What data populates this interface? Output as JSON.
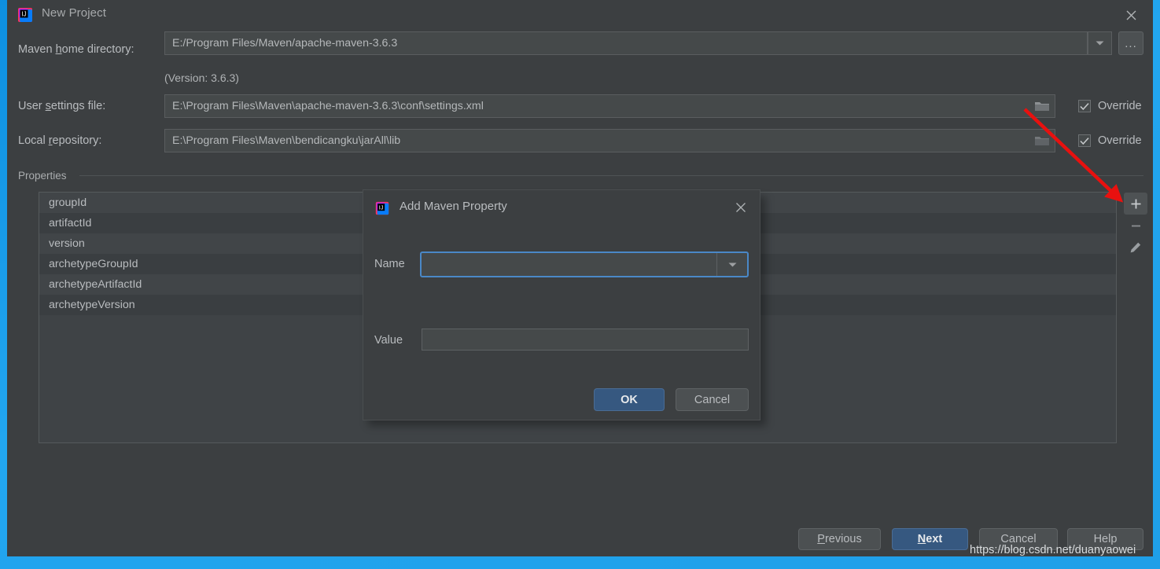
{
  "window": {
    "title": "New Project",
    "logo_icon": "intellij-idea-logo",
    "close_icon": "close-icon"
  },
  "form": {
    "maven_home": {
      "label_pre": "Maven ",
      "label_mnemonic": "h",
      "label_post": "ome directory:",
      "value": "E:/Program Files/Maven/apache-maven-3.6.3",
      "dropdown_icon": "chevron-down-icon",
      "browse_label": "...",
      "version_note": "(Version: 3.6.3)"
    },
    "user_settings": {
      "label_pre": "User ",
      "label_mnemonic": "s",
      "label_post": "ettings file:",
      "value": "E:\\Program Files\\Maven\\apache-maven-3.6.3\\conf\\settings.xml",
      "folder_icon": "folder-icon",
      "override_label": "Override",
      "override_checked": true
    },
    "local_repository": {
      "label_pre": "Local ",
      "label_mnemonic": "r",
      "label_post": "epository:",
      "value": "E:\\Program Files\\Maven\\bendicangku\\jarAll\\lib",
      "folder_icon": "folder-icon",
      "override_label": "Override",
      "override_checked": true
    }
  },
  "properties": {
    "section_label": "Properties",
    "rows": [
      "groupId",
      "artifactId",
      "version",
      "archetypeGroupId",
      "archetypeArtifactId",
      "archetypeVersion"
    ],
    "tools": [
      {
        "name": "add-property-button",
        "icon": "plus-icon",
        "hovered": true
      },
      {
        "name": "remove-property-button",
        "icon": "minus-icon",
        "hovered": false
      },
      {
        "name": "edit-property-button",
        "icon": "pencil-icon",
        "hovered": false
      }
    ]
  },
  "modal": {
    "title": "Add Maven Property",
    "logo_icon": "intellij-idea-logo",
    "close_icon": "close-icon",
    "name_label": "Name",
    "name_value": "",
    "name_dropdown_icon": "chevron-down-icon",
    "value_label": "Value",
    "value_value": "",
    "ok_label": "OK",
    "cancel_label": "Cancel"
  },
  "footer": {
    "previous_pre": "",
    "previous_mnemonic": "P",
    "previous_post": "revious",
    "next_pre": "",
    "next_mnemonic": "N",
    "next_post": "ext",
    "cancel_label": "Cancel",
    "help_label": "Help"
  },
  "annotation": {
    "watermark": "https://blog.csdn.net/duanyaowei",
    "arrow_color": "#e8110f"
  },
  "colors": {
    "window_bg": "#3c3f41",
    "field_bg": "#45494a",
    "accent_blue": "#365880",
    "focus_blue": "#4a88c7",
    "desktop_blue": "#1a9ae8"
  }
}
